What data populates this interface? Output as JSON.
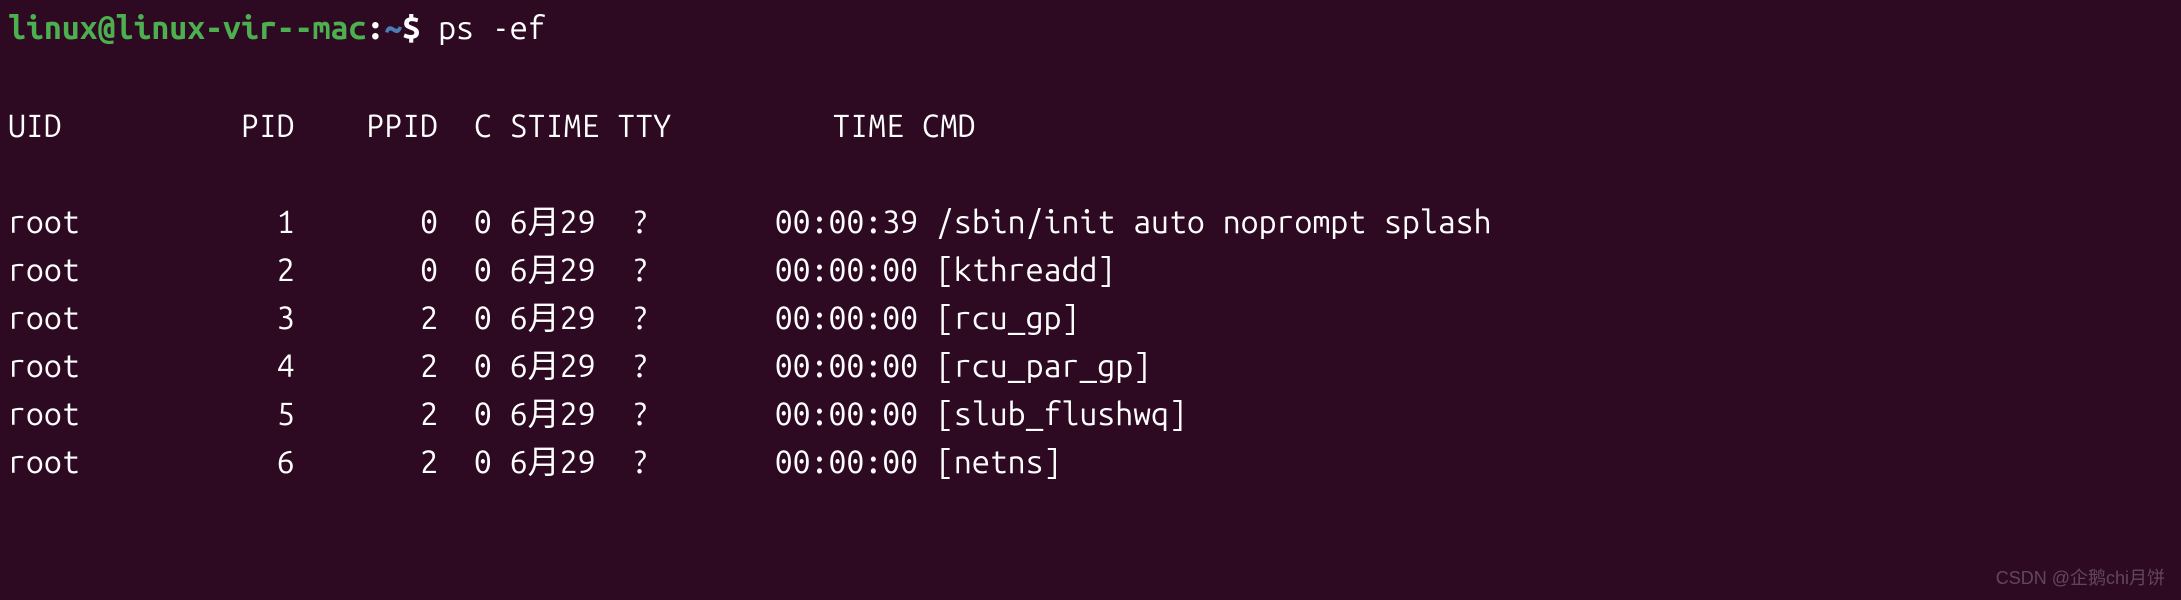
{
  "prompt": {
    "user_host": "linux@linux-vir--mac",
    "colon": ":",
    "path": "~",
    "dollar": "$ ",
    "command": "ps -ef"
  },
  "header": {
    "uid": "UID",
    "pid": "PID",
    "ppid": "PPID",
    "c": "C",
    "stime": "STIME",
    "tty": "TTY",
    "time": "TIME",
    "cmd": "CMD"
  },
  "rows": [
    {
      "uid": "root",
      "pid": "1",
      "ppid": "0",
      "c": "0",
      "stime": "6月29",
      "tty": "?",
      "time": "00:00:39",
      "cmd": "/sbin/init auto noprompt splash"
    },
    {
      "uid": "root",
      "pid": "2",
      "ppid": "0",
      "c": "0",
      "stime": "6月29",
      "tty": "?",
      "time": "00:00:00",
      "cmd": "[kthreadd]"
    },
    {
      "uid": "root",
      "pid": "3",
      "ppid": "2",
      "c": "0",
      "stime": "6月29",
      "tty": "?",
      "time": "00:00:00",
      "cmd": "[rcu_gp]"
    },
    {
      "uid": "root",
      "pid": "4",
      "ppid": "2",
      "c": "0",
      "stime": "6月29",
      "tty": "?",
      "time": "00:00:00",
      "cmd": "[rcu_par_gp]"
    },
    {
      "uid": "root",
      "pid": "5",
      "ppid": "2",
      "c": "0",
      "stime": "6月29",
      "tty": "?",
      "time": "00:00:00",
      "cmd": "[slub_flushwq]"
    },
    {
      "uid": "root",
      "pid": "6",
      "ppid": "2",
      "c": "0",
      "stime": "6月29",
      "tty": "?",
      "time": "00:00:00",
      "cmd": "[netns]"
    }
  ],
  "watermark": "CSDN @企鹅chi月饼"
}
